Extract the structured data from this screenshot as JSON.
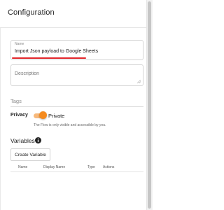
{
  "header": {
    "title": "Configuration"
  },
  "form": {
    "name_label": "Name",
    "name_value": "Import Json payload to Google Sheets",
    "description_placeholder": "Description",
    "tags_label": "Tags",
    "privacy_label": "Privacy",
    "privacy_toggle_text": "Private",
    "privacy_toggle_on": true,
    "privacy_help": "The Flow is only visible and accessible by you."
  },
  "variables": {
    "title": "Variables",
    "create_button": "Create Variable",
    "columns": [
      "Name",
      "Display Name",
      "Type",
      "Actions"
    ],
    "rows": []
  },
  "colors": {
    "toggle_accent": "#f58b1f",
    "annotation_underline": "#e3262a"
  }
}
